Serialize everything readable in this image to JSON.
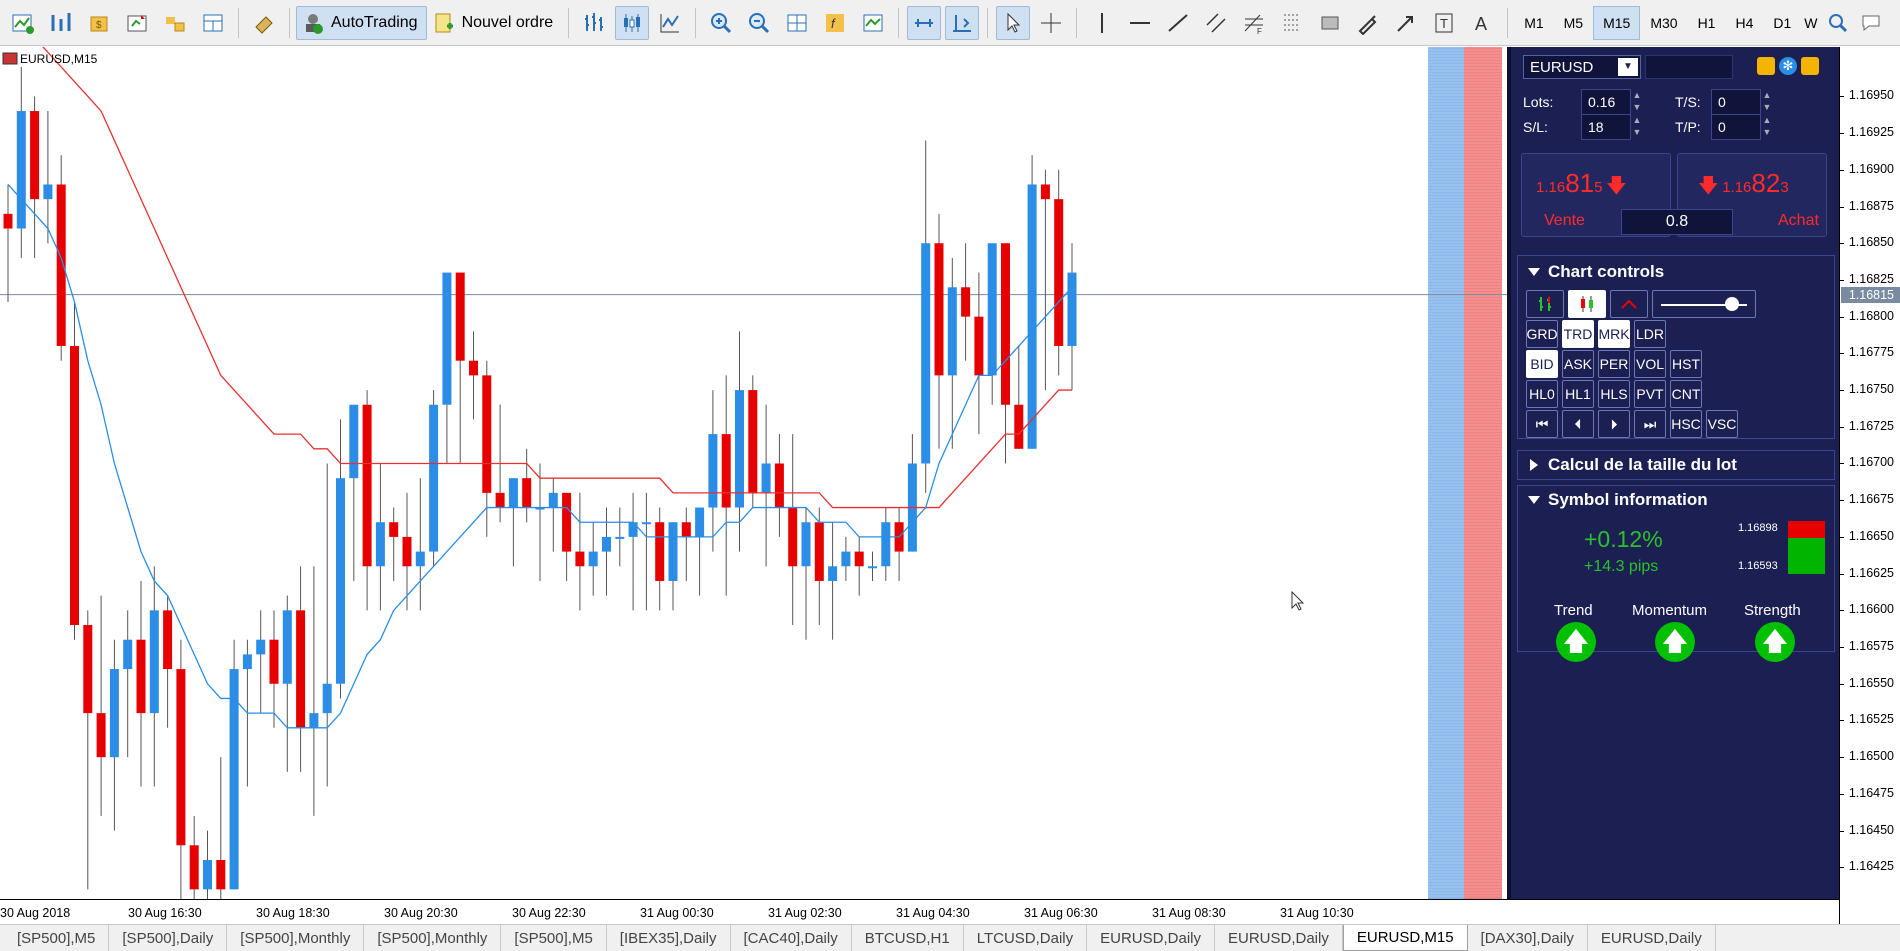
{
  "toolbar": {
    "autotrading_label": "AutoTrading",
    "new_order_label": "Nouvel ordre",
    "timeframes": [
      "M1",
      "M5",
      "M15",
      "M30",
      "H1",
      "H4",
      "D1",
      "W"
    ],
    "active_timeframe": "M15"
  },
  "chart": {
    "symbol_label": "EURUSD,M15",
    "current_price": "1.16815",
    "price_labels": [
      "1.16950",
      "1.16925",
      "1.16900",
      "1.16875",
      "1.16850",
      "1.16825",
      "1.16800",
      "1.16775",
      "1.16750",
      "1.16725",
      "1.16700",
      "1.16675",
      "1.16650",
      "1.16625",
      "1.16600",
      "1.16575",
      "1.16550",
      "1.16525",
      "1.16500",
      "1.16475",
      "1.16450",
      "1.16425"
    ],
    "time_labels": [
      "30 Aug 2018",
      "30 Aug 16:30",
      "30 Aug 18:30",
      "30 Aug 20:30",
      "30 Aug 22:30",
      "31 Aug 00:30",
      "31 Aug 02:30",
      "31 Aug 04:30",
      "31 Aug 06:30",
      "31 Aug 08:30",
      "31 Aug 10:30"
    ],
    "colors": {
      "bull": "#2b8de6",
      "bear": "#e60000",
      "ma_fast": "#2b8de6",
      "ma_slow": "#e83030"
    }
  },
  "chart_data": {
    "type": "candlestick",
    "ylim": [
      1.1641,
      1.1697
    ],
    "candles": [
      [
        1.1687,
        1.1689,
        1.1681,
        1.1686
      ],
      [
        1.1686,
        1.1697,
        1.1684,
        1.1694
      ],
      [
        1.1694,
        1.1695,
        1.1684,
        1.1688
      ],
      [
        1.1688,
        1.1694,
        1.1685,
        1.1689
      ],
      [
        1.1689,
        1.1691,
        1.1677,
        1.1678
      ],
      [
        1.1678,
        1.1681,
        1.1658,
        1.1659
      ],
      [
        1.1659,
        1.166,
        1.1641,
        1.1653
      ],
      [
        1.1653,
        1.1661,
        1.1646,
        1.165
      ],
      [
        1.165,
        1.1658,
        1.1645,
        1.1656
      ],
      [
        1.1656,
        1.166,
        1.165,
        1.1658
      ],
      [
        1.1658,
        1.1662,
        1.1648,
        1.1653
      ],
      [
        1.1653,
        1.1663,
        1.1648,
        1.166
      ],
      [
        1.166,
        1.1661,
        1.1652,
        1.1656
      ],
      [
        1.1656,
        1.1658,
        1.164,
        1.1644
      ],
      [
        1.1644,
        1.1646,
        1.164,
        1.1641
      ],
      [
        1.1641,
        1.1645,
        1.1639,
        1.1643
      ],
      [
        1.1643,
        1.165,
        1.164,
        1.1641
      ],
      [
        1.1641,
        1.1658,
        1.1641,
        1.1656
      ],
      [
        1.1656,
        1.1658,
        1.1648,
        1.1657
      ],
      [
        1.1657,
        1.166,
        1.1653,
        1.1658
      ],
      [
        1.1658,
        1.166,
        1.1652,
        1.1655
      ],
      [
        1.1655,
        1.1661,
        1.1649,
        1.166
      ],
      [
        1.166,
        1.1663,
        1.1649,
        1.1652
      ],
      [
        1.1652,
        1.1663,
        1.1646,
        1.1653
      ],
      [
        1.1653,
        1.167,
        1.1648,
        1.1655
      ],
      [
        1.1655,
        1.1673,
        1.1654,
        1.1669
      ],
      [
        1.1669,
        1.1674,
        1.1662,
        1.1674
      ],
      [
        1.1674,
        1.1675,
        1.166,
        1.1663
      ],
      [
        1.1663,
        1.167,
        1.166,
        1.1666
      ],
      [
        1.1666,
        1.1667,
        1.1662,
        1.1665
      ],
      [
        1.1665,
        1.1668,
        1.166,
        1.1663
      ],
      [
        1.1663,
        1.1669,
        1.166,
        1.1664
      ],
      [
        1.1664,
        1.1675,
        1.1663,
        1.1674
      ],
      [
        1.1674,
        1.168,
        1.167,
        1.1683
      ],
      [
        1.1683,
        1.1683,
        1.167,
        1.1677
      ],
      [
        1.1677,
        1.1679,
        1.1673,
        1.1676
      ],
      [
        1.1676,
        1.1677,
        1.1665,
        1.1668
      ],
      [
        1.1668,
        1.1674,
        1.1666,
        1.1667
      ],
      [
        1.1667,
        1.1669,
        1.1663,
        1.1669
      ],
      [
        1.1669,
        1.1671,
        1.1666,
        1.1667
      ],
      [
        1.1667,
        1.167,
        1.1662,
        1.1667
      ],
      [
        1.1667,
        1.1669,
        1.1664,
        1.1668
      ],
      [
        1.1668,
        1.1668,
        1.1662,
        1.1664
      ],
      [
        1.1664,
        1.1668,
        1.166,
        1.1663
      ],
      [
        1.1663,
        1.1666,
        1.1661,
        1.1664
      ],
      [
        1.1664,
        1.1667,
        1.1661,
        1.1665
      ],
      [
        1.1665,
        1.1667,
        1.1663,
        1.1665
      ],
      [
        1.1665,
        1.1668,
        1.166,
        1.1666
      ],
      [
        1.1666,
        1.1668,
        1.166,
        1.1666
      ],
      [
        1.1666,
        1.1667,
        1.166,
        1.1662
      ],
      [
        1.1662,
        1.1666,
        1.166,
        1.1666
      ],
      [
        1.1666,
        1.1667,
        1.1662,
        1.1665
      ],
      [
        1.1665,
        1.1667,
        1.1661,
        1.1667
      ],
      [
        1.1667,
        1.1675,
        1.1664,
        1.1672
      ],
      [
        1.1672,
        1.1676,
        1.1661,
        1.1667
      ],
      [
        1.1667,
        1.1679,
        1.1664,
        1.1675
      ],
      [
        1.1675,
        1.1676,
        1.1667,
        1.1668
      ],
      [
        1.1668,
        1.1674,
        1.1663,
        1.167
      ],
      [
        1.167,
        1.1672,
        1.1665,
        1.1667
      ],
      [
        1.1667,
        1.1672,
        1.1659,
        1.1663
      ],
      [
        1.1663,
        1.1667,
        1.1658,
        1.1666
      ],
      [
        1.1666,
        1.1667,
        1.1659,
        1.1662
      ],
      [
        1.1662,
        1.1666,
        1.1658,
        1.1663
      ],
      [
        1.1663,
        1.1665,
        1.1662,
        1.1664
      ],
      [
        1.1664,
        1.1665,
        1.1661,
        1.1663
      ],
      [
        1.1663,
        1.1664,
        1.1662,
        1.1663
      ],
      [
        1.1663,
        1.1667,
        1.1662,
        1.1666
      ],
      [
        1.1666,
        1.1667,
        1.1662,
        1.1664
      ],
      [
        1.1664,
        1.1672,
        1.1664,
        1.167
      ],
      [
        1.167,
        1.1692,
        1.1668,
        1.1685
      ],
      [
        1.1685,
        1.1687,
        1.1671,
        1.1676
      ],
      [
        1.1676,
        1.1684,
        1.1671,
        1.1682
      ],
      [
        1.1682,
        1.1685,
        1.1677,
        1.168
      ],
      [
        1.168,
        1.1683,
        1.1672,
        1.1676
      ],
      [
        1.1676,
        1.1684,
        1.1674,
        1.1685
      ],
      [
        1.1685,
        1.1685,
        1.167,
        1.1674
      ],
      [
        1.1674,
        1.1678,
        1.1671,
        1.1671
      ],
      [
        1.1671,
        1.1691,
        1.1671,
        1.1689
      ],
      [
        1.1689,
        1.169,
        1.1675,
        1.1688
      ],
      [
        1.1688,
        1.169,
        1.1676,
        1.1678
      ],
      [
        1.1678,
        1.1685,
        1.1675,
        1.1683
      ]
    ],
    "ma_fast": [
      1.1689,
      1.1688,
      1.1687,
      1.1686,
      1.1684,
      1.1681,
      1.1677,
      1.1674,
      1.167,
      1.1667,
      1.1664,
      1.1662,
      1.1661,
      1.1659,
      1.1657,
      1.1655,
      1.1654,
      1.1654,
      1.1653,
      1.1653,
      1.1653,
      1.1652,
      1.1652,
      1.1652,
      1.1652,
      1.1653,
      1.1655,
      1.1657,
      1.1658,
      1.166,
      1.1661,
      1.1662,
      1.1663,
      1.1664,
      1.1665,
      1.1666,
      1.1667,
      1.1667,
      1.1667,
      1.1667,
      1.1667,
      1.1667,
      1.1667,
      1.1666,
      1.1666,
      1.1666,
      1.1666,
      1.1666,
      1.1665,
      1.1665,
      1.1665,
      1.1665,
      1.1665,
      1.1665,
      1.1666,
      1.1666,
      1.1667,
      1.1667,
      1.1667,
      1.1667,
      1.1667,
      1.1666,
      1.1666,
      1.1666,
      1.1665,
      1.1665,
      1.1665,
      1.1665,
      1.1666,
      1.1667,
      1.167,
      1.1672,
      1.1674,
      1.1676,
      1.1676,
      1.1677,
      1.1678,
      1.1679,
      1.168,
      1.1681,
      1.1682
    ],
    "ma_slow": [
      1.17,
      1.1699,
      1.1699,
      1.1698,
      1.1697,
      1.1696,
      1.1695,
      1.1694,
      1.1692,
      1.169,
      1.1688,
      1.1686,
      1.1684,
      1.1682,
      1.168,
      1.1678,
      1.1676,
      1.1675,
      1.1674,
      1.1673,
      1.1672,
      1.1672,
      1.1672,
      1.1671,
      1.1671,
      1.167,
      1.167,
      1.167,
      1.167,
      1.167,
      1.167,
      1.167,
      1.167,
      1.167,
      1.167,
      1.167,
      1.167,
      1.167,
      1.167,
      1.167,
      1.1669,
      1.1669,
      1.1669,
      1.1669,
      1.1669,
      1.1669,
      1.1669,
      1.1669,
      1.1669,
      1.1669,
      1.1668,
      1.1668,
      1.1668,
      1.1668,
      1.1668,
      1.1668,
      1.1668,
      1.1668,
      1.1668,
      1.1668,
      1.1668,
      1.1668,
      1.1667,
      1.1667,
      1.1667,
      1.1667,
      1.1667,
      1.1667,
      1.1667,
      1.1667,
      1.1667,
      1.1668,
      1.1669,
      1.167,
      1.1671,
      1.1672,
      1.1672,
      1.1673,
      1.1674,
      1.1675,
      1.1675
    ]
  },
  "panel": {
    "symbol": "EURUSD",
    "lots_label": "Lots:",
    "lots": "0.16",
    "sl_label": "S/L:",
    "sl": "18",
    "ts_label": "T/S:",
    "ts": "0",
    "tp_label": "T/P:",
    "tp": "0",
    "sell_prefix": "1.16",
    "sell_big": "81",
    "sell_small": "5",
    "sell_label": "Vente",
    "buy_prefix": "1.16",
    "buy_big": "82",
    "buy_small": "3",
    "buy_label": "Achat",
    "spread": "0.8",
    "chart_controls_title": "Chart controls",
    "row2": [
      "GRD",
      "TRD",
      "MRK",
      "LDR"
    ],
    "row3": [
      "BID",
      "ASK",
      "PER",
      "VOL",
      "HST"
    ],
    "row4": [
      "HL0",
      "HL1",
      "HLS",
      "PVT",
      "CNT"
    ],
    "row5_text": [
      "HSC",
      "VSC"
    ],
    "lot_calc_title": "Calcul de la taille du lot",
    "symbol_info_title": "Symbol information",
    "change_pct": "+0.12%",
    "change_pips": "+14.3 pips",
    "range_high": "1.16898",
    "range_low": "1.16593",
    "trend_label": "Trend",
    "momentum_label": "Momentum",
    "strength_label": "Strength"
  },
  "tabs": [
    "[SP500],M5",
    "[SP500],Daily",
    "[SP500],Monthly",
    "[SP500],Monthly",
    "[SP500],M5",
    "[IBEX35],Daily",
    "[CAC40],Daily",
    "BTCUSD,H1",
    "LTCUSD,Daily",
    "EURUSD,Daily",
    "EURUSD,Daily",
    "EURUSD,M15",
    "[DAX30],Daily",
    "EURUSD,Daily"
  ],
  "active_tab": "EURUSD,M15"
}
